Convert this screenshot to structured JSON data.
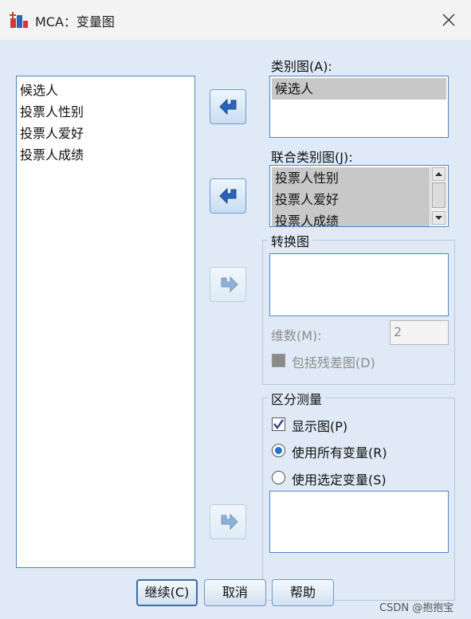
{
  "window": {
    "title": "MCA：变量图"
  },
  "source_list": {
    "items": [
      "候选人",
      "投票人性别",
      "投票人爱好",
      "投票人成绩"
    ]
  },
  "category_plot": {
    "label": "类别图(A):",
    "items": [
      "候选人"
    ]
  },
  "joint_category_plot": {
    "label": "联合类别图(J):",
    "items": [
      "投票人性别",
      "投票人爱好",
      "投票人成绩"
    ]
  },
  "transformation_plot": {
    "legend": "转换图",
    "dimensions_label": "维数(M):",
    "dimensions_value": "2",
    "include_residual_label": "包括残差图(D)"
  },
  "discrimination_measures": {
    "legend": "区分测量",
    "display_plot_label": "显示图(P)",
    "display_plot_checked": true,
    "use_all_label": "使用所有变量(R)",
    "use_selected_label": "使用选定变量(S)",
    "selected_option": "use_all"
  },
  "buttons": {
    "continue": "继续(C)",
    "cancel": "取消",
    "help": "帮助"
  },
  "watermark": "CSDN @抱抱宝",
  "colors": {
    "dialog_bg": "#dfeaf6",
    "list_border": "#4e86c4",
    "selection_bg": "#c8c8c8",
    "radio_accent": "#2a6fc9"
  },
  "icons": {
    "app": "spss-chart-icon",
    "close": "close-icon",
    "move_left": "arrow-left-icon",
    "move_right": "arrow-right-icon"
  }
}
